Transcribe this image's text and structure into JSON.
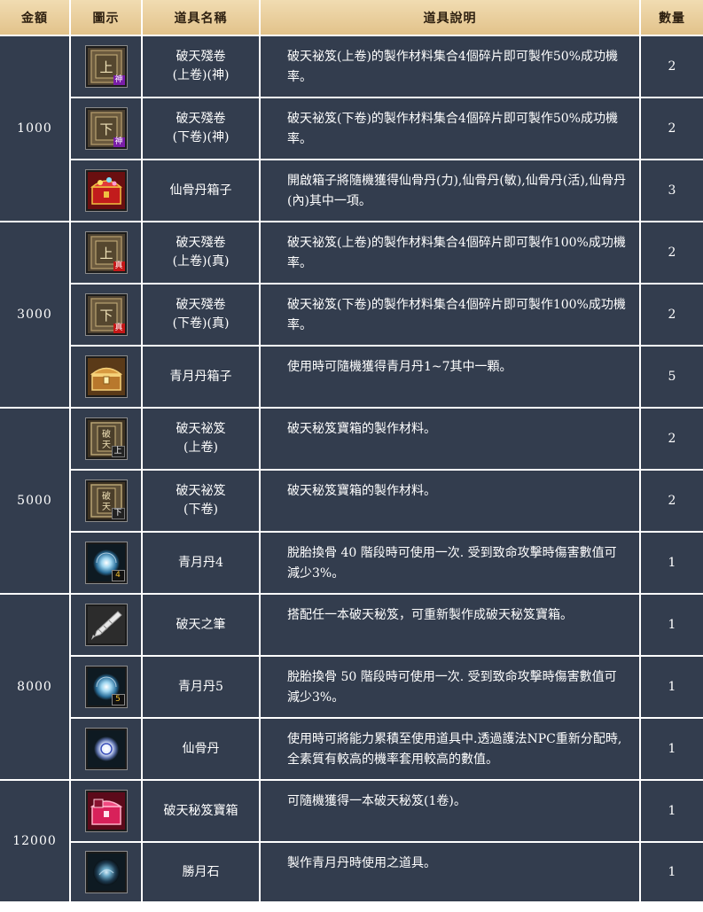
{
  "headers": {
    "amount": "金額",
    "icon": "圖示",
    "name": "道具名稱",
    "desc": "道具說明",
    "qty": "數量"
  },
  "tiers": [
    {
      "amount": "1000",
      "items": [
        {
          "icon": "scroll-upper-icon",
          "badge": "神",
          "glyph": "上",
          "name": "破天殘卷",
          "sub": "(上卷)(神)",
          "desc": "破天祕笈(上卷)的製作材料集合4個碎片即可製作50%成功機率。",
          "qty": "2"
        },
        {
          "icon": "scroll-lower-icon",
          "badge": "神",
          "glyph": "下",
          "name": "破天殘卷",
          "sub": "(下卷)(神)",
          "desc": "破天祕笈(下卷)的製作材料集合4個碎片即可製作50%成功機率。",
          "qty": "2"
        },
        {
          "icon": "red-treasure-chest-icon",
          "name": "仙骨丹箱子",
          "sub": "",
          "desc": "開啟箱子將隨機獲得仙骨丹(力),仙骨丹(敏),仙骨丹(活),仙骨丹(內)其中一項。",
          "qty": "3"
        }
      ]
    },
    {
      "amount": "3000",
      "items": [
        {
          "icon": "scroll-upper-icon",
          "badge": "真",
          "glyph": "上",
          "name": "破天殘卷",
          "sub": "(上卷)(真)",
          "desc": "破天祕笈(上卷)的製作材料集合4個碎片即可製作100%成功機率。",
          "qty": "2"
        },
        {
          "icon": "scroll-lower-icon",
          "badge": "真",
          "glyph": "下",
          "name": "破天殘卷",
          "sub": "(下卷)(真)",
          "desc": "破天祕笈(下卷)的製作材料集合4個碎片即可製作100%成功機率。",
          "qty": "2"
        },
        {
          "icon": "gold-treasure-chest-icon",
          "name": "青月丹箱子",
          "sub": "",
          "desc": "使用時可隨機獲得青月丹1~7其中一顆。",
          "qty": "5"
        }
      ]
    },
    {
      "amount": "5000",
      "items": [
        {
          "icon": "secret-book-upper-icon",
          "badge": "上",
          "glyph": "破天",
          "name": "破天祕笈",
          "sub": "(上卷)",
          "desc": "破天秘笈寶箱的製作材料。",
          "qty": "2"
        },
        {
          "icon": "secret-book-lower-icon",
          "badge": "下",
          "glyph": "破天",
          "name": "破天祕笈",
          "sub": "(下卷)",
          "desc": "破天秘笈寶箱的製作材料。",
          "qty": "2"
        },
        {
          "icon": "blue-orb-icon",
          "badge": "4",
          "name": "青月丹4",
          "sub": "",
          "desc": "脫胎換骨 40 階段時可使用一次. 受到致命攻擊時傷害數值可減少3%。",
          "qty": "1"
        }
      ]
    },
    {
      "amount": "8000",
      "items": [
        {
          "icon": "brush-icon",
          "name": "破天之筆",
          "sub": "",
          "desc": "搭配任一本破天秘笈，可重新製作成破天秘笈寶箱。",
          "qty": "1"
        },
        {
          "icon": "blue-orb-icon",
          "badge": "5",
          "name": "青月丹5",
          "sub": "",
          "desc": "脫胎換骨 50 階段時可使用一次. 受到致命攻擊時傷害數值可減少3%。",
          "qty": "1"
        },
        {
          "icon": "white-orb-icon",
          "name": "仙骨丹",
          "sub": "",
          "desc": "使用時可將能力累積至使用道具中.透過護法NPC重新分配時,全素質有較高的機率套用較高的數值。",
          "qty": "1"
        }
      ]
    },
    {
      "amount": "12000",
      "items": [
        {
          "icon": "pink-treasure-chest-icon",
          "name": "破天秘笈寶箱",
          "sub": "",
          "desc": "可隨機獲得一本破天秘笈(1卷)。",
          "qty": "1"
        },
        {
          "icon": "dark-orb-icon",
          "name": "勝月石",
          "sub": "",
          "desc": "製作青月丹時使用之道具。",
          "qty": "1"
        }
      ]
    }
  ],
  "colors": {
    "header_bg": "#e6c890",
    "row_bg": "#333d4e",
    "grid_line": "#ffffff",
    "badge_purple": "#7a1ea8",
    "badge_red": "#c41818"
  }
}
